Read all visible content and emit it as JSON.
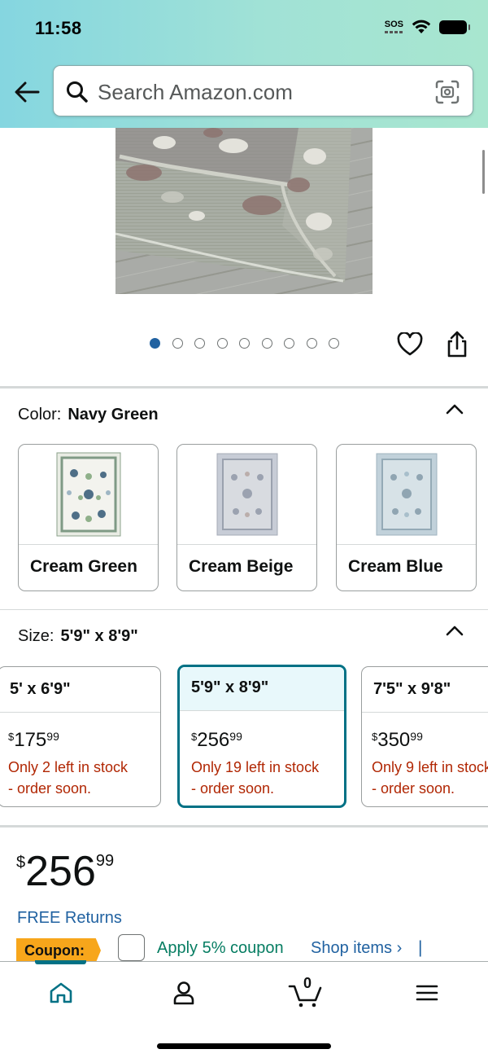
{
  "status_bar": {
    "time": "11:58",
    "sos": "SOS"
  },
  "search": {
    "placeholder": "Search Amazon.com"
  },
  "gallery": {
    "image_count": 9,
    "active_index": 0
  },
  "color": {
    "label": "Color:",
    "selected": "Navy Green",
    "options": [
      {
        "label": "Cream Green"
      },
      {
        "label": "Cream Beige"
      },
      {
        "label": "Cream Blue"
      }
    ]
  },
  "size": {
    "label": "Size:",
    "selected": "5'9\" x 8'9\"",
    "options": [
      {
        "label": "5' x 6'9\"",
        "currency": "$",
        "whole": "175",
        "cents": "99",
        "stock_line1": "Only 2 left in stock",
        "stock_line2": "- order soon."
      },
      {
        "label": "5'9\" x 8'9\"",
        "currency": "$",
        "whole": "256",
        "cents": "99",
        "stock_line1": "Only 19 left in stock",
        "stock_line2": "- order soon."
      },
      {
        "label": "7'5\" x 9'8\"",
        "currency": "$",
        "whole": "350",
        "cents": "99",
        "stock_line1": "Only 9 left in stock",
        "stock_line2": "- order soon."
      }
    ]
  },
  "price": {
    "currency": "$",
    "whole": "256",
    "cents": "99"
  },
  "returns": "FREE Returns",
  "coupon": {
    "tag": "Coupon:",
    "text": "Apply 5% coupon",
    "shop_items": "Shop items ›",
    "separator": "|"
  },
  "bottom_nav": {
    "cart_count": "0"
  },
  "colors": {
    "link": "#2162a1",
    "stock_red": "#b12704",
    "selected_border": "#007185",
    "coupon_orange": "#f7a61b",
    "coupon_green": "#067d62"
  }
}
